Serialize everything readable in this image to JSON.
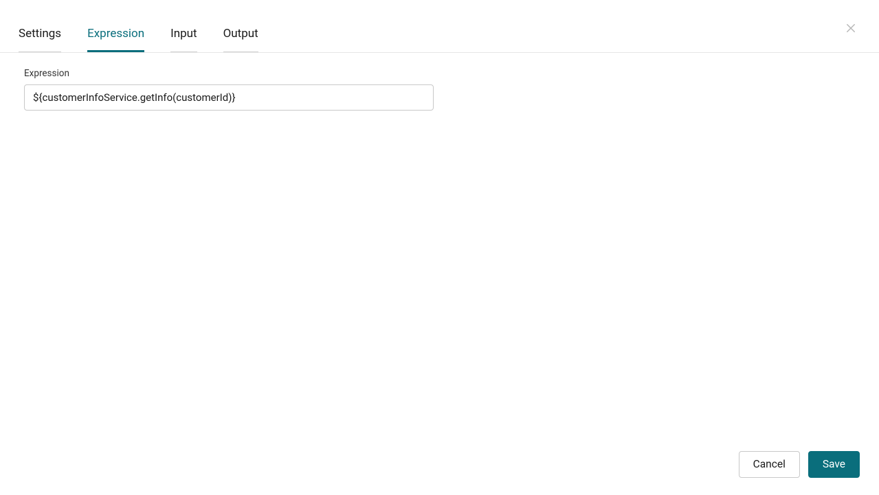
{
  "tabs": [
    {
      "label": "Settings",
      "active": false,
      "underline": true
    },
    {
      "label": "Expression",
      "active": true,
      "underline": false
    },
    {
      "label": "Input",
      "active": false,
      "underline": true
    },
    {
      "label": "Output",
      "active": false,
      "underline": true
    }
  ],
  "form": {
    "expression_label": "Expression",
    "expression_value": "${customerInfoService.getInfo(customerId)}"
  },
  "footer": {
    "cancel_label": "Cancel",
    "save_label": "Save"
  },
  "colors": {
    "accent": "#0a6e7c"
  }
}
